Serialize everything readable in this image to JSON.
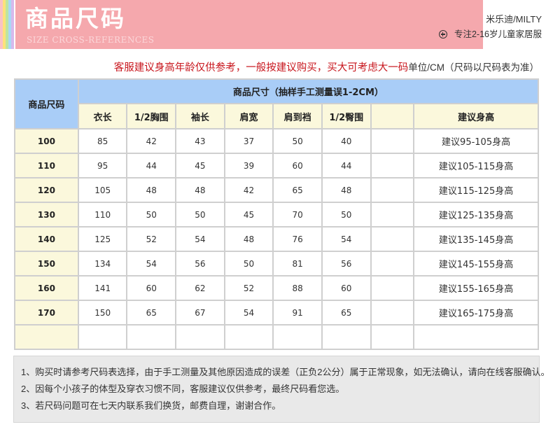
{
  "header": {
    "title": "商品尺码",
    "subtitle": "SIZE CROSS-REFERENCES",
    "brand": "米乐迪/MILTY",
    "tagline": "专注2-16岁儿童家居服",
    "tagline_icon": "plus-circle-icon",
    "banner_color": "#f5a8ad",
    "stripe_colors": [
      "#f9c2c6",
      "#fde27a",
      "#bfe4a0",
      "#a9d8f5",
      "#d7b9ec"
    ]
  },
  "note": {
    "advice": "客服建议身高年龄仅供参考，一般按建议购买，买大可考虑大一码",
    "unit": "单位/CM（尺码以尺码表为准）",
    "advice_color": "#c8161d"
  },
  "table": {
    "size_header": "商品尺码",
    "group_header": "商品尺寸（抽样手工测量误1-2CM）",
    "columns": [
      "衣长",
      "1/2胸围",
      "袖长",
      "肩宽",
      "肩到裆",
      "1/2臀围",
      "",
      "建议身高"
    ],
    "rows": [
      {
        "size": "100",
        "values": [
          "85",
          "42",
          "43",
          "37",
          "50",
          "40",
          ""
        ],
        "rec": "建议95-105身高"
      },
      {
        "size": "110",
        "values": [
          "95",
          "44",
          "45",
          "39",
          "60",
          "44",
          ""
        ],
        "rec": "建议105-115身高"
      },
      {
        "size": "120",
        "values": [
          "105",
          "48",
          "48",
          "42",
          "65",
          "48",
          ""
        ],
        "rec": "建议115-125身高"
      },
      {
        "size": "130",
        "values": [
          "110",
          "50",
          "50",
          "45",
          "70",
          "50",
          ""
        ],
        "rec": "建议125-135身高"
      },
      {
        "size": "140",
        "values": [
          "125",
          "52",
          "54",
          "48",
          "76",
          "54",
          ""
        ],
        "rec": "建议135-145身高"
      },
      {
        "size": "150",
        "values": [
          "134",
          "54",
          "56",
          "50",
          "81",
          "56",
          ""
        ],
        "rec": "建议145-155身高"
      },
      {
        "size": "160",
        "values": [
          "141",
          "60",
          "62",
          "52",
          "88",
          "60",
          ""
        ],
        "rec": "建议155-165身高"
      },
      {
        "size": "170",
        "values": [
          "150",
          "65",
          "67",
          "54",
          "91",
          "65",
          ""
        ],
        "rec": "建议165-175身高"
      }
    ],
    "header_blue": "#a9cdf7",
    "header_yellow": "#fbf8dc"
  },
  "footer": {
    "lines": [
      "1、购买时请参考尺码表选择，由于手工测量及其他原因造成的误差（正负2公分）属于正常现象，如无法确认，请向在线客服确认。",
      "2、因每个小孩子的体型及穿衣习惯不同，客服建议仅供参考，最终尺码看您选。",
      "3、若尺码问题可在七天内联系我们换货，邮费自理，谢谢合作。"
    ]
  }
}
